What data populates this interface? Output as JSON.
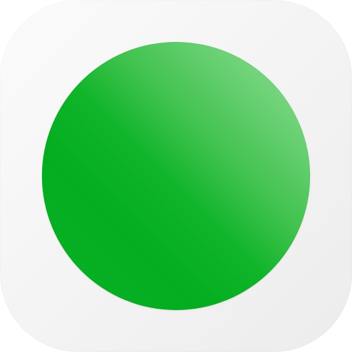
{
  "icon": {
    "name": "green-circle-app-icon",
    "shape": "rounded-square",
    "glyph": "filled-circle",
    "colors": {
      "background_light": "#fbfbfb",
      "background_dark": "#ececec",
      "circle_highlight": "#8fdc94",
      "circle_main": "#0ab227"
    }
  }
}
